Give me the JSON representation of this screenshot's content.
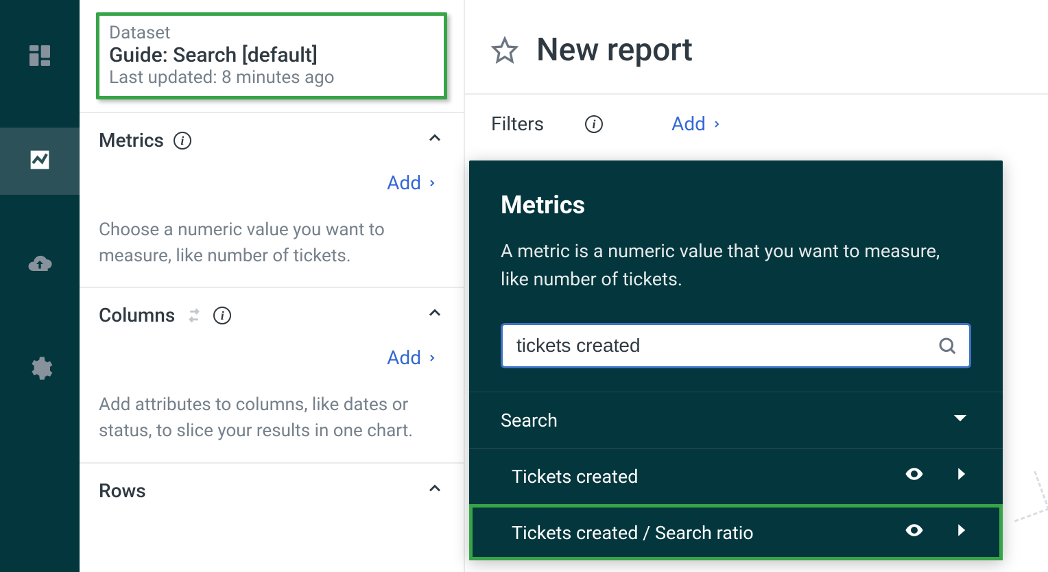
{
  "sidenav": {
    "items": [
      "dashboard",
      "reports",
      "upload",
      "settings"
    ],
    "active_index": 1
  },
  "dataset_panel": {
    "label": "Dataset",
    "name": "Guide: Search [default]",
    "updated": "Last updated: 8 minutes ago"
  },
  "sections": {
    "metrics": {
      "title": "Metrics",
      "add_label": "Add",
      "hint": "Choose a numeric value you want to measure, like number of tickets."
    },
    "columns": {
      "title": "Columns",
      "add_label": "Add",
      "hint": "Add attributes to columns, like dates or status, to slice your results in one chart."
    },
    "rows": {
      "title": "Rows"
    }
  },
  "header": {
    "report_title": "New report"
  },
  "filters": {
    "label": "Filters",
    "add_label": "Add"
  },
  "metrics_popover": {
    "heading": "Metrics",
    "description": "A metric is a numeric value that you want to measure, like number of tickets.",
    "search_value": "tickets created",
    "category": "Search",
    "results": [
      {
        "label": "Tickets created"
      },
      {
        "label": "Tickets created / Search ratio"
      }
    ]
  }
}
